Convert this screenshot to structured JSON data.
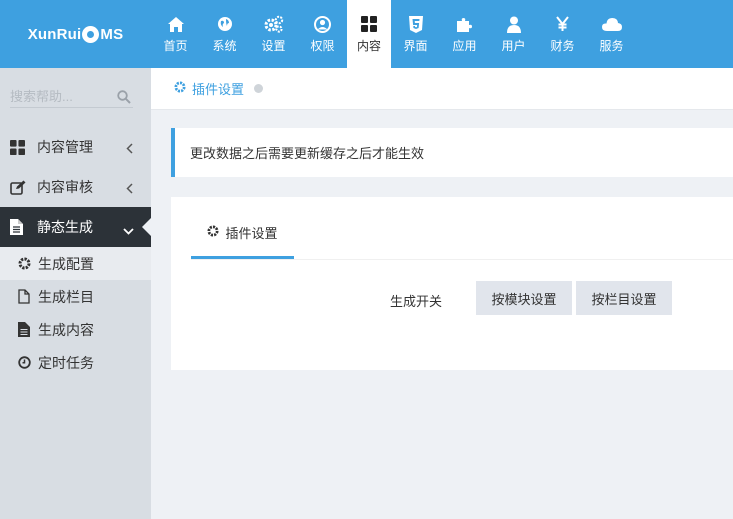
{
  "app": {
    "logo_text_1": "XunRui",
    "logo_text_2": "MS"
  },
  "nav": {
    "items": [
      {
        "label": "首页",
        "icon": "home-icon"
      },
      {
        "label": "系统",
        "icon": "globe-icon"
      },
      {
        "label": "设置",
        "icon": "gears-icon"
      },
      {
        "label": "权限",
        "icon": "user-circle-icon"
      },
      {
        "label": "内容",
        "icon": "grid-icon",
        "active": true
      },
      {
        "label": "界面",
        "icon": "html5-icon"
      },
      {
        "label": "应用",
        "icon": "puzzle-icon"
      },
      {
        "label": "用户",
        "icon": "user-icon"
      },
      {
        "label": "财务",
        "icon": "yen-icon"
      },
      {
        "label": "服务",
        "icon": "cloud-icon"
      }
    ]
  },
  "sidebar": {
    "search_placeholder": "搜索帮助...",
    "menu": [
      {
        "label": "内容管理",
        "icon": "grid-icon"
      },
      {
        "label": "内容审核",
        "icon": "edit-icon"
      },
      {
        "label": "静态生成",
        "icon": "file-icon",
        "active": true
      }
    ],
    "submenu": [
      {
        "label": "生成配置",
        "icon": "gear-icon",
        "active": true
      },
      {
        "label": "生成栏目",
        "icon": "file-outline-icon"
      },
      {
        "label": "生成内容",
        "icon": "file-text-icon"
      },
      {
        "label": "定时任务",
        "icon": "clock-icon"
      }
    ]
  },
  "breadcrumb": {
    "label": "插件设置"
  },
  "notice": {
    "text": "更改数据之后需要更新缓存之后才能生效"
  },
  "card": {
    "tab_label": "插件设置",
    "field_label": "生成开关",
    "button_module": "按模块设置",
    "button_column": "按栏目设置"
  },
  "colors": {
    "accent": "#3ea0e0",
    "sidebar_bg": "#d8dde3",
    "sidebar_active": "#2c3238"
  }
}
